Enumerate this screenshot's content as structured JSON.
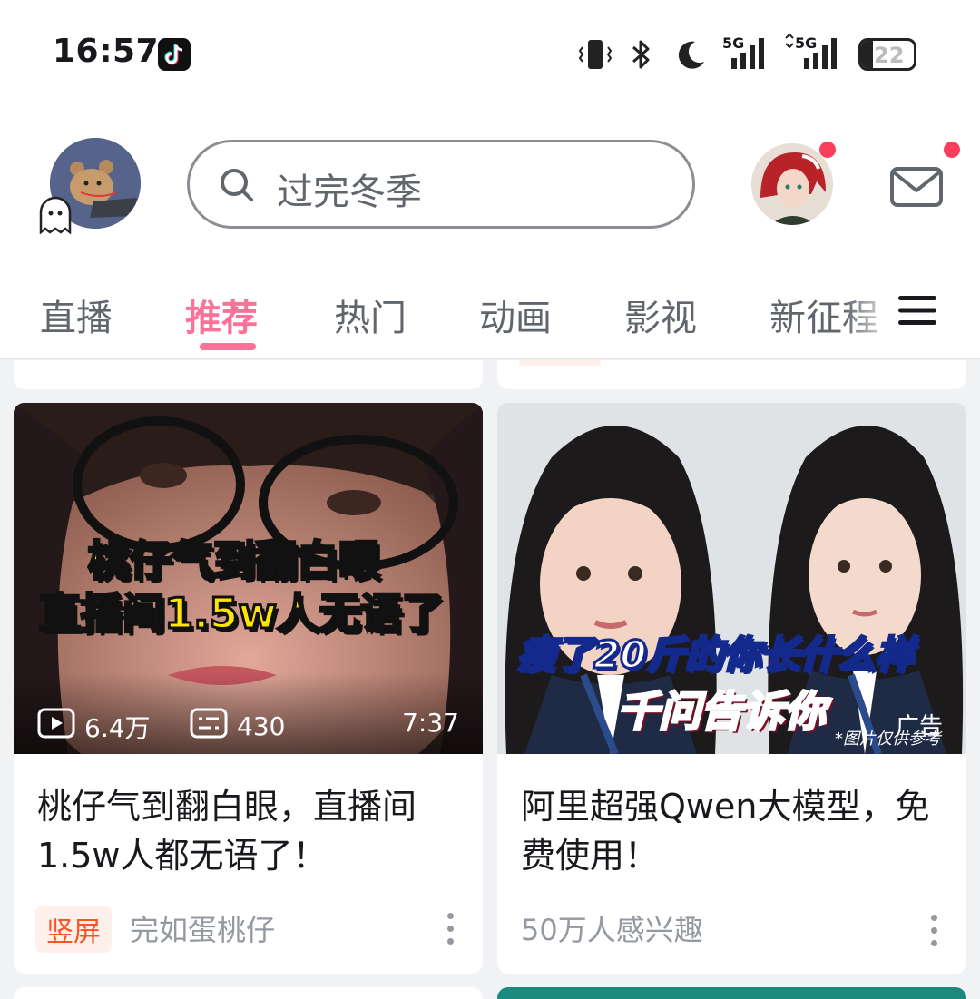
{
  "status_bar": {
    "time": "16:57",
    "network_1": "5G",
    "network_2": "5G",
    "battery": "22",
    "battery_level": 0.22
  },
  "header": {
    "search_placeholder": "过完冬季"
  },
  "tabs": [
    {
      "label": "直播",
      "active": false
    },
    {
      "label": "推荐",
      "active": true
    },
    {
      "label": "热门",
      "active": false
    },
    {
      "label": "动画",
      "active": false
    },
    {
      "label": "影视",
      "active": false
    },
    {
      "label": "新征程",
      "active": false
    }
  ],
  "feed": {
    "cards": [
      {
        "overlay_line1": "桃仔气到翻白眼",
        "overlay_line2": "直播间1.5w人无语了",
        "views": "6.4万",
        "comments": "430",
        "duration": "7:37",
        "title": "桃仔气到翻白眼，直播间1.5w人都无语了！",
        "badge": "竖屏",
        "author": "完如蛋桃仔"
      },
      {
        "overlay_line1": "瘦了20斤的你长什么样",
        "overlay_line2": "千问告诉你",
        "overlay_note": "*图片仅供参考",
        "ad_label": "广告",
        "title": "阿里超强Qwen大模型，免费使用！",
        "meta": "50万人感兴趣"
      }
    ]
  },
  "colors": {
    "accent": "#fb7299",
    "notification": "#fb3e5b",
    "badge_text": "#f8551f"
  }
}
